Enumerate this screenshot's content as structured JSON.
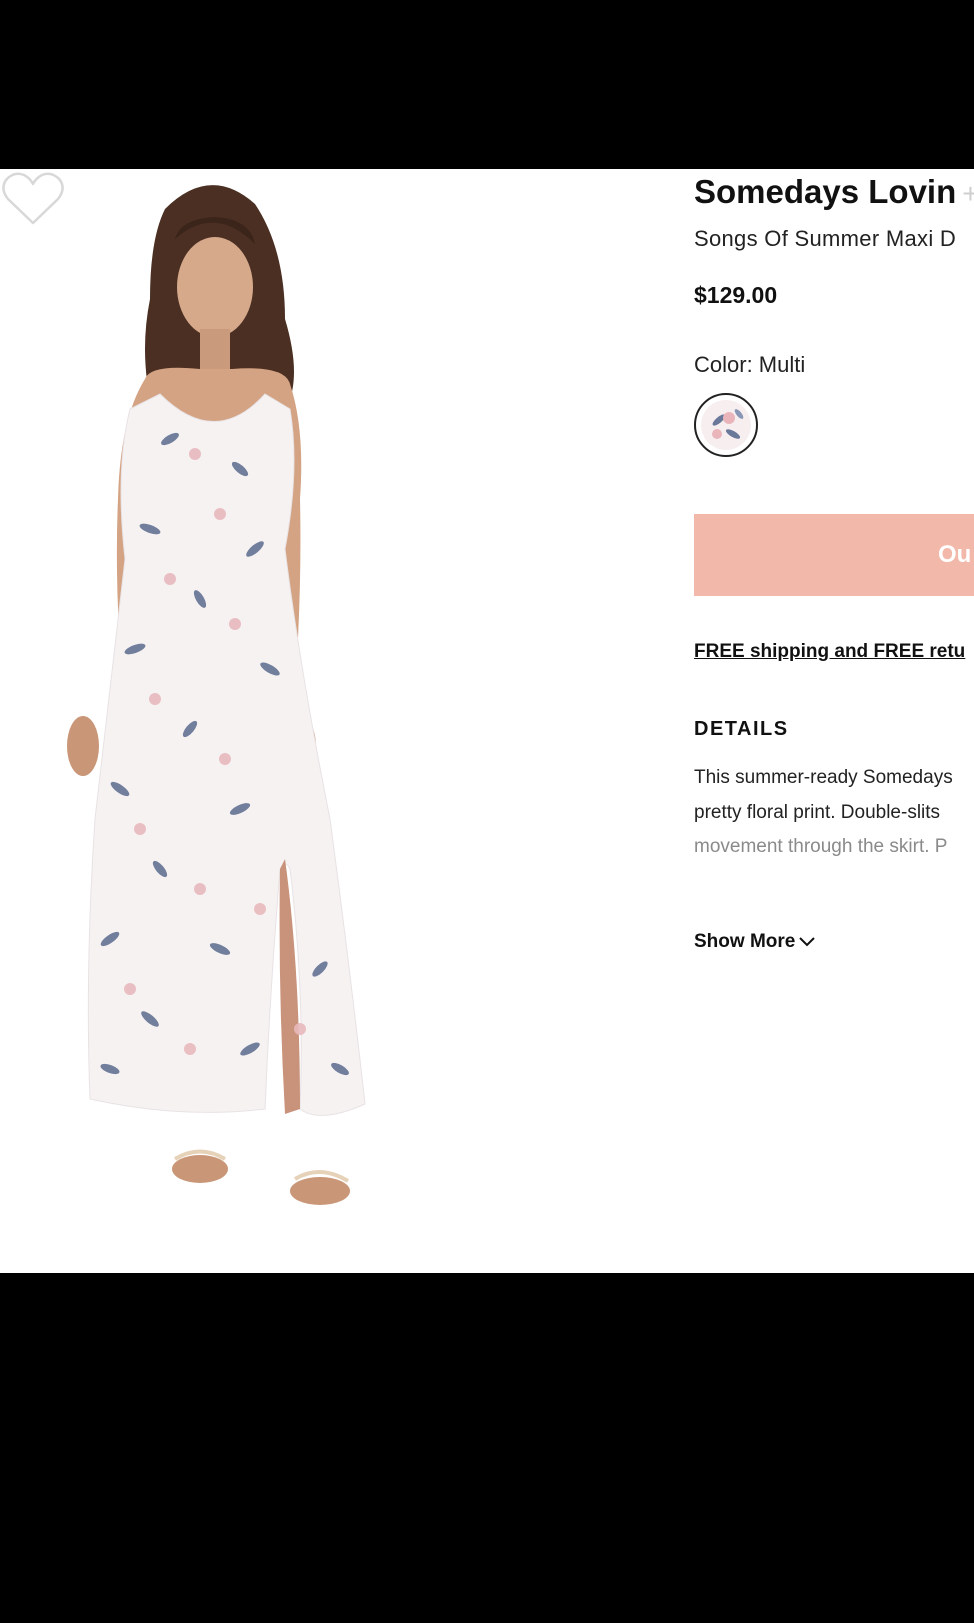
{
  "product": {
    "brand": "Somedays Lovin",
    "brand_plus": "+",
    "name": "Songs Of Summer Maxi D",
    "price": "$129.00",
    "color_label": "Color: Multi",
    "cta_label": "Ou",
    "shipping_link": "FREE shipping and FREE retu",
    "details_heading": "DETAILS",
    "description_lines": [
      "This summer-ready Somedays",
      "pretty floral print. Double-slits",
      "movement through the skirt. P"
    ],
    "show_more": "Show More"
  },
  "icons": {
    "wishlist": "heart-outline-icon",
    "show_more": "chevron-down-icon"
  },
  "colors": {
    "cta_background": "#f2b8aa",
    "page_background": "#ffffff",
    "frame": "#000000"
  }
}
